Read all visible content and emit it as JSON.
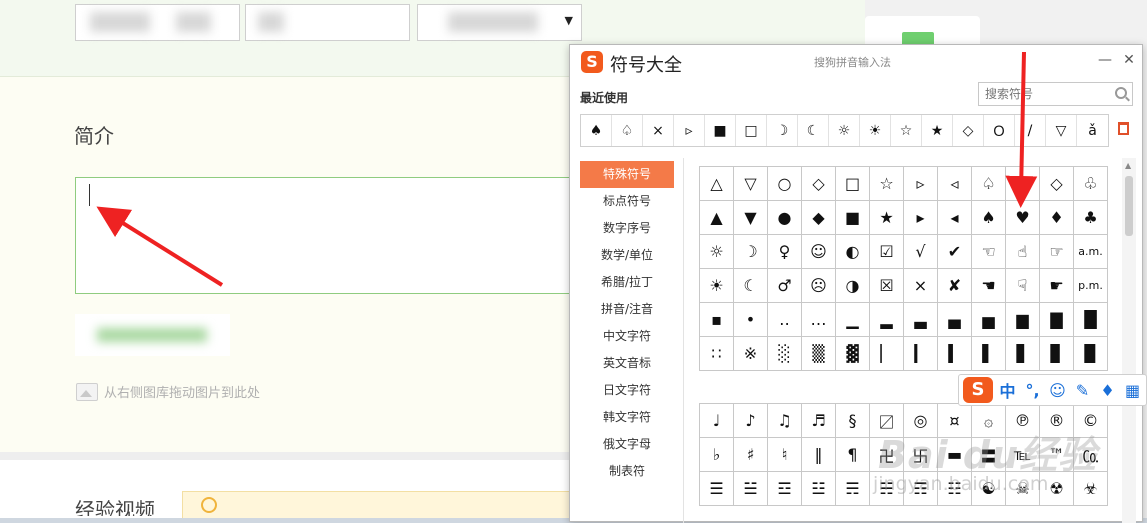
{
  "page": {
    "intro_heading": "简介",
    "image_hint": "从右侧图库拖动图片到此处",
    "video_heading": "经验视频"
  },
  "popup": {
    "title": "符号大全",
    "subtitle": "搜狗拼音输入法",
    "minimize_label": "—",
    "close_label": "✕",
    "recent_label": "最近使用",
    "search_placeholder": "搜索符号",
    "recent_symbols": [
      "♠",
      "♤",
      "×",
      "▹",
      "■",
      "□",
      "☽",
      "☾",
      "☼",
      "☀",
      "☆",
      "★",
      "◇",
      "Ｏ",
      "/",
      "▽",
      "ǎ"
    ],
    "categories": [
      {
        "label": "特殊符号",
        "active": true
      },
      {
        "label": "标点符号",
        "active": false
      },
      {
        "label": "数字序号",
        "active": false
      },
      {
        "label": "数学/单位",
        "active": false
      },
      {
        "label": "希腊/拉丁",
        "active": false
      },
      {
        "label": "拼音/注音",
        "active": false
      },
      {
        "label": "中文字符",
        "active": false
      },
      {
        "label": "英文音标",
        "active": false
      },
      {
        "label": "日文字符",
        "active": false
      },
      {
        "label": "韩文字符",
        "active": false
      },
      {
        "label": "俄文字母",
        "active": false
      },
      {
        "label": "制表符",
        "active": false
      }
    ],
    "symbol_grid_1": [
      [
        "△",
        "▽",
        "○",
        "◇",
        "□",
        "☆",
        "▹",
        "◃",
        "♤",
        "♡",
        "◇",
        "♧"
      ],
      [
        "▲",
        "▼",
        "●",
        "◆",
        "■",
        "★",
        "▸",
        "◂",
        "♠",
        "♥",
        "♦",
        "♣"
      ],
      [
        "☼",
        "☽",
        "♀",
        "☺",
        "◐",
        "☑",
        "√",
        "✔",
        "☜",
        "☝",
        "☞",
        "a.m."
      ],
      [
        "☀",
        "☾",
        "♂",
        "☹",
        "◑",
        "☒",
        "×",
        "✘",
        "☚",
        "☟",
        "☛",
        "p.m."
      ],
      [
        "▪",
        "•",
        "‥",
        "…",
        "▁",
        "▂",
        "▃",
        "▄",
        "▅",
        "▆",
        "▇",
        "█"
      ],
      [
        "∷",
        "※",
        "░",
        "▒",
        "▓",
        "▏",
        "▎",
        "▍",
        "▌",
        "▋",
        "▊",
        "▉"
      ]
    ],
    "symbol_grid_2": [
      [
        "♩",
        "♪",
        "♫",
        "♬",
        "§",
        "〼",
        "◎",
        "¤",
        "۞",
        "℗",
        "®",
        "©"
      ],
      [
        "♭",
        "♯",
        "♮",
        "‖",
        "¶",
        "卍",
        "卐",
        "▬",
        "〓",
        "℡",
        "™",
        "㏇"
      ],
      [
        "☰",
        "☱",
        "☲",
        "☳",
        "☴",
        "☵",
        "☶",
        "☷",
        "☯",
        "☠",
        "☢",
        "☣"
      ]
    ]
  },
  "ime_toolbar": {
    "logo": "S",
    "items": [
      {
        "name": "mode-chinese",
        "label": "中"
      },
      {
        "name": "punctuation",
        "label": "°,"
      },
      {
        "name": "emoji",
        "label": "☺"
      },
      {
        "name": "handwrite",
        "label": "✎"
      },
      {
        "name": "voice",
        "label": "♦"
      },
      {
        "name": "toolbox",
        "label": "▦"
      }
    ]
  },
  "watermark": {
    "brand": "Bai du经验",
    "url": "jingyan.baidu.com"
  },
  "colors": {
    "sogou_orange": "#f25a1d",
    "active_category": "#f47a48",
    "textarea_border": "#8fcc7f",
    "annotation_arrow": "#ee2222",
    "ime_blue": "#1a6fd8"
  }
}
